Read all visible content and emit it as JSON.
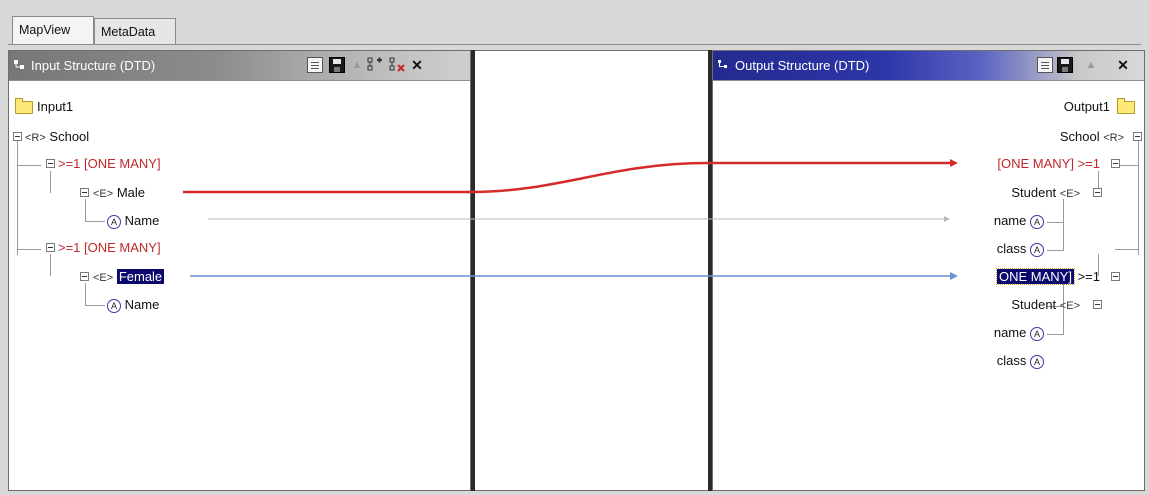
{
  "tabs": [
    {
      "label": "MapView"
    },
    {
      "label": "MetaData"
    }
  ],
  "input": {
    "title": "Input Structure (DTD)",
    "tree": {
      "root_folder": "Input1",
      "school": {
        "tag": "<R>",
        "label": "School"
      },
      "group1": {
        "label": ">=1 [ONE MANY]"
      },
      "male": {
        "tag": "<E>",
        "label": "Male"
      },
      "male_attr": {
        "icon": "A",
        "label": "Name"
      },
      "group2": {
        "label": ">=1 [ONE MANY]"
      },
      "female": {
        "tag": "<E>",
        "label": "Female"
      },
      "female_attr": {
        "icon": "A",
        "label": "Name"
      }
    }
  },
  "output": {
    "title": "Output Structure (DTD)",
    "tree": {
      "root_folder": "Output1",
      "school": {
        "tag": "<R>",
        "label": "School"
      },
      "group1": {
        "label": "[ONE MANY]",
        "suffix": ">=1"
      },
      "student1": {
        "tag": "<E>",
        "label": "Student"
      },
      "name1": {
        "icon": "A",
        "label": "name"
      },
      "class1": {
        "icon": "A",
        "label": "class"
      },
      "group2": {
        "label": "ONE MANY]",
        "suffix": ">=1"
      },
      "student2": {
        "tag": "<E>",
        "label": "Student"
      },
      "name2": {
        "icon": "A",
        "label": "name"
      },
      "class2": {
        "icon": "A",
        "label": "class"
      }
    }
  },
  "mappings": [
    {
      "from": "input.male",
      "to": "output.group1",
      "color": "#d42a2a"
    },
    {
      "from": "input.male_attr",
      "to": "output.name1",
      "color": "#b8b8b8"
    },
    {
      "from": "input.female",
      "to": "output.group2",
      "color": "#6a94cf"
    }
  ],
  "colors": {
    "accent": "#2d36a8",
    "selection": "#0a0a6e",
    "mapping_red": "#d42a2a",
    "mapping_blue": "#6a94cf"
  }
}
